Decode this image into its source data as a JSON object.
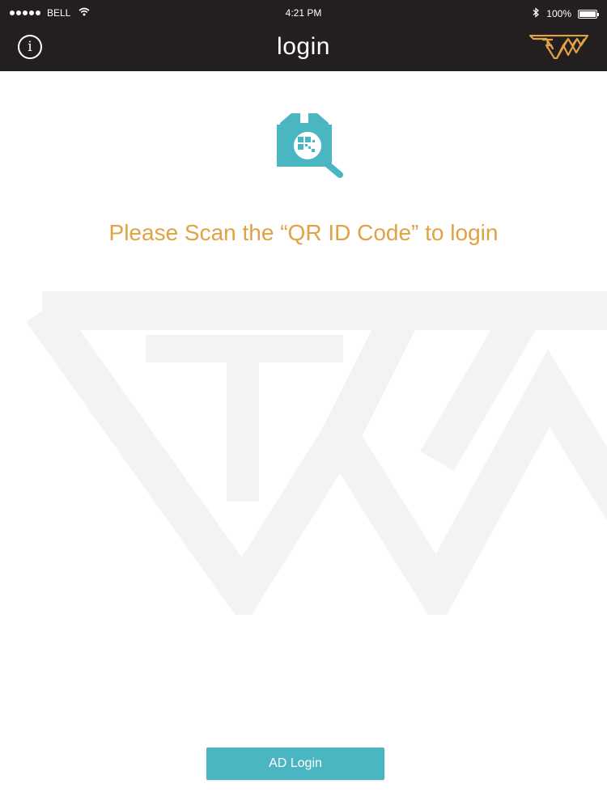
{
  "colors": {
    "bar_background": "#231f20",
    "accent_gold": "#e0a244",
    "accent_teal": "#4ab6c1",
    "watermark": "#f4f4f6"
  },
  "status_bar": {
    "carrier": "BELL",
    "time": "4:21 PM",
    "battery_percent": "100%",
    "battery_level": 1.0,
    "icons": [
      "signal-dots-icon",
      "wifi-icon",
      "bluetooth-icon",
      "battery-icon"
    ]
  },
  "nav": {
    "title": "login",
    "left_icon": "info-icon",
    "right_icon": "brand-logo"
  },
  "main": {
    "icon": "qr-scan-icon",
    "prompt": "Please Scan the “QR ID Code” to login",
    "button_label": "AD Login"
  }
}
